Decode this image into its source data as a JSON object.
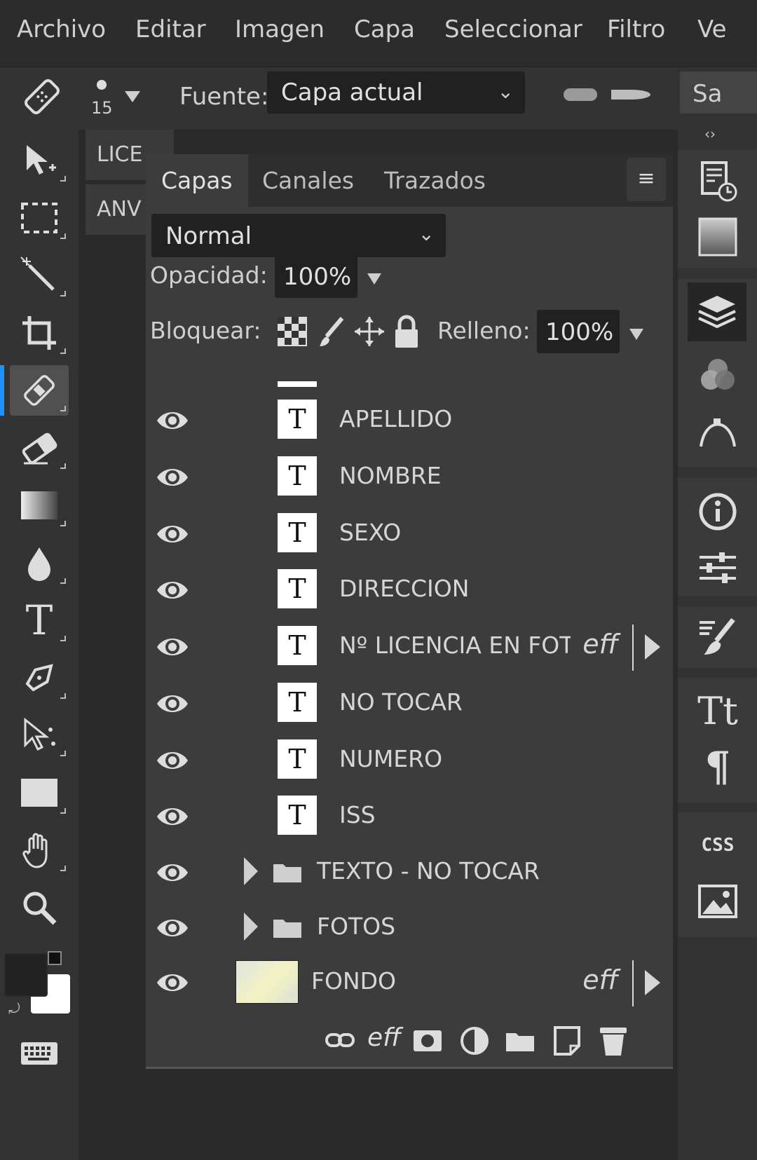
{
  "menu": [
    "Archivo",
    "Editar",
    "Imagen",
    "Capa",
    "Seleccionar",
    "Filtro",
    "Ve"
  ],
  "options": {
    "brush_size": "15",
    "source_label": "Fuente:",
    "source_value": "Capa actual",
    "sample_button": "Sa"
  },
  "document_tabs": [
    "LICE",
    "ANV"
  ],
  "layers_panel": {
    "tabs": [
      "Capas",
      "Canales",
      "Trazados"
    ],
    "menu_icon": "≡",
    "blend_mode": "Normal",
    "opacity_label": "Opacidad:",
    "opacity_value": "100%",
    "lock_label": "Bloquear:",
    "fill_label": "Relleno:",
    "fill_value": "100%",
    "text_thumb_glyph": "T",
    "fx_label": "eff",
    "layers": [
      {
        "name": "APELLIDO",
        "type": "text"
      },
      {
        "name": "NOMBRE",
        "type": "text"
      },
      {
        "name": "SEXO",
        "type": "text"
      },
      {
        "name": "DIRECCION",
        "type": "text"
      },
      {
        "name": "Nº LICENCIA EN FOT",
        "type": "text",
        "fx": true
      },
      {
        "name": "NO TOCAR",
        "type": "text"
      },
      {
        "name": "NUMERO",
        "type": "text"
      },
      {
        "name": "ISS",
        "type": "text"
      },
      {
        "name": "TEXTO - NO TOCAR",
        "type": "folder"
      },
      {
        "name": "FOTOS",
        "type": "folder"
      },
      {
        "name": "FONDO",
        "type": "image",
        "fx": true
      }
    ],
    "footer_icons": [
      "link-icon",
      "effects-icon",
      "mask-icon",
      "adjustment-icon",
      "new-group-icon",
      "new-layer-icon",
      "delete-icon"
    ]
  },
  "dock_icons": [
    "history-icon",
    "swatches-icon",
    "layers-icon",
    "channels-icon",
    "paths-icon",
    "info-icon",
    "adjustments-icon",
    "brush-settings-icon",
    "character-icon",
    "paragraph-icon",
    "css-icon",
    "image-icon"
  ],
  "dock_css_label": "CSS",
  "colors": {
    "accent": "#1e90ff",
    "panel": "#3c3c3c",
    "dark": "#2a2a2a"
  }
}
